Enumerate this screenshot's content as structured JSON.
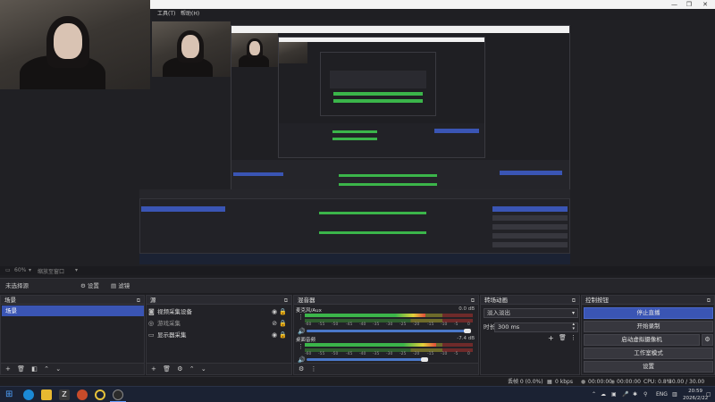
{
  "preview": {
    "menu_tools": "工具(T)",
    "menu_help": "帮助(H)",
    "zoom_label": "60%",
    "zoom_mode": "缩放至窗口"
  },
  "scene_toolbar": {
    "scene_name": "未选择源",
    "properties_label": "设置",
    "filters_label": "滤镜"
  },
  "scenes": {
    "title": "场景",
    "items": [
      "场景"
    ]
  },
  "sources": {
    "title": "源",
    "items": [
      {
        "icon": "camera-icon",
        "label": "视频采集设备"
      },
      {
        "icon": "gamepad-icon",
        "label": "游戏采集"
      },
      {
        "icon": "monitor-icon",
        "label": "显示器采集"
      }
    ]
  },
  "mixer": {
    "title": "混音器",
    "channels": [
      {
        "name": "麦克风/Aux",
        "db": "0.0 dB",
        "level": 0.72,
        "volume": 0.98
      },
      {
        "name": "桌面音频",
        "db": "-7.4 dB",
        "level": 0.78,
        "volume": 0.72
      }
    ],
    "ticks": [
      "-60",
      "-55",
      "-50",
      "-45",
      "-40",
      "-35",
      "-30",
      "-25",
      "-20",
      "-15",
      "-10",
      "-5",
      "0"
    ]
  },
  "transitions": {
    "title": "转场动画",
    "selected": "淡入淡出",
    "duration_label": "时长",
    "duration_value": "300 ms"
  },
  "controls": {
    "title": "控制按钮",
    "buttons": [
      "停止直播",
      "开始录制",
      "启动虚拟摄像机",
      "工作室模式",
      "设置"
    ]
  },
  "stats": {
    "dropped": "丢帧 0 (0.0%)",
    "bitrate": "0 kbps",
    "rec_time": "00:00:00",
    "live_time": "00:00:00",
    "cpu": "CPU: 0.8%",
    "fps": "30.00 / 30.00 FPS"
  },
  "taskbar": {
    "lang": "ENG",
    "time": "20:59",
    "date": "2026/2/22"
  },
  "colors": {
    "accent": "#3a55b4",
    "meter_green": "#3bb54a",
    "meter_yellow": "#e3d13a",
    "meter_red": "#e34a3a"
  }
}
